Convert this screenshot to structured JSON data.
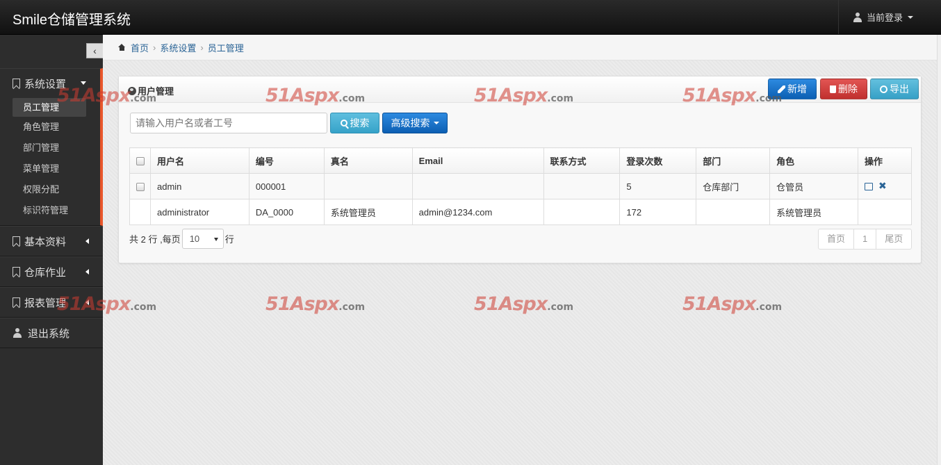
{
  "navbar": {
    "brand": "Smile仓储管理系统",
    "user_label": "当前登录"
  },
  "sidebar": {
    "sections": [
      {
        "label": "系统设置",
        "items": [
          "员工管理",
          "角色管理",
          "部门管理",
          "菜单管理",
          "权限分配",
          "标识符管理"
        ]
      },
      {
        "label": "基本资料"
      },
      {
        "label": "仓库作业"
      },
      {
        "label": "报表管理"
      },
      {
        "label": "退出系统"
      }
    ]
  },
  "breadcrumb": {
    "home": "首页",
    "level1": "系统设置",
    "level2": "员工管理"
  },
  "panel": {
    "title": "用户管理",
    "buttons": {
      "add": "新增",
      "delete": "删除",
      "export": "导出"
    },
    "search_placeholder": "请输入用户名或者工号",
    "search_label": "搜索",
    "advanced_label": "高级搜索"
  },
  "table": {
    "headers": [
      "用户名",
      "编号",
      "真名",
      "Email",
      "联系方式",
      "登录次数",
      "部门",
      "角色",
      "操作"
    ],
    "rows": [
      {
        "username": "admin",
        "code": "000001",
        "realname": "",
        "email": "",
        "contact": "",
        "logins": "5",
        "dept": "仓库部门",
        "role": "仓管员"
      },
      {
        "username": "administrator",
        "code": "DA_0000",
        "realname": "系统管理员",
        "email": "admin@1234.com",
        "contact": "",
        "logins": "172",
        "dept": "",
        "role": "系统管理员"
      }
    ]
  },
  "footer": {
    "total_prefix": "共 2 行 ,每页",
    "page_size": "10",
    "suffix": "行"
  },
  "pager": {
    "first": "首页",
    "current": "1",
    "last": "尾页"
  },
  "watermark": {
    "text": "51Aspx",
    "suffix": ".com"
  }
}
